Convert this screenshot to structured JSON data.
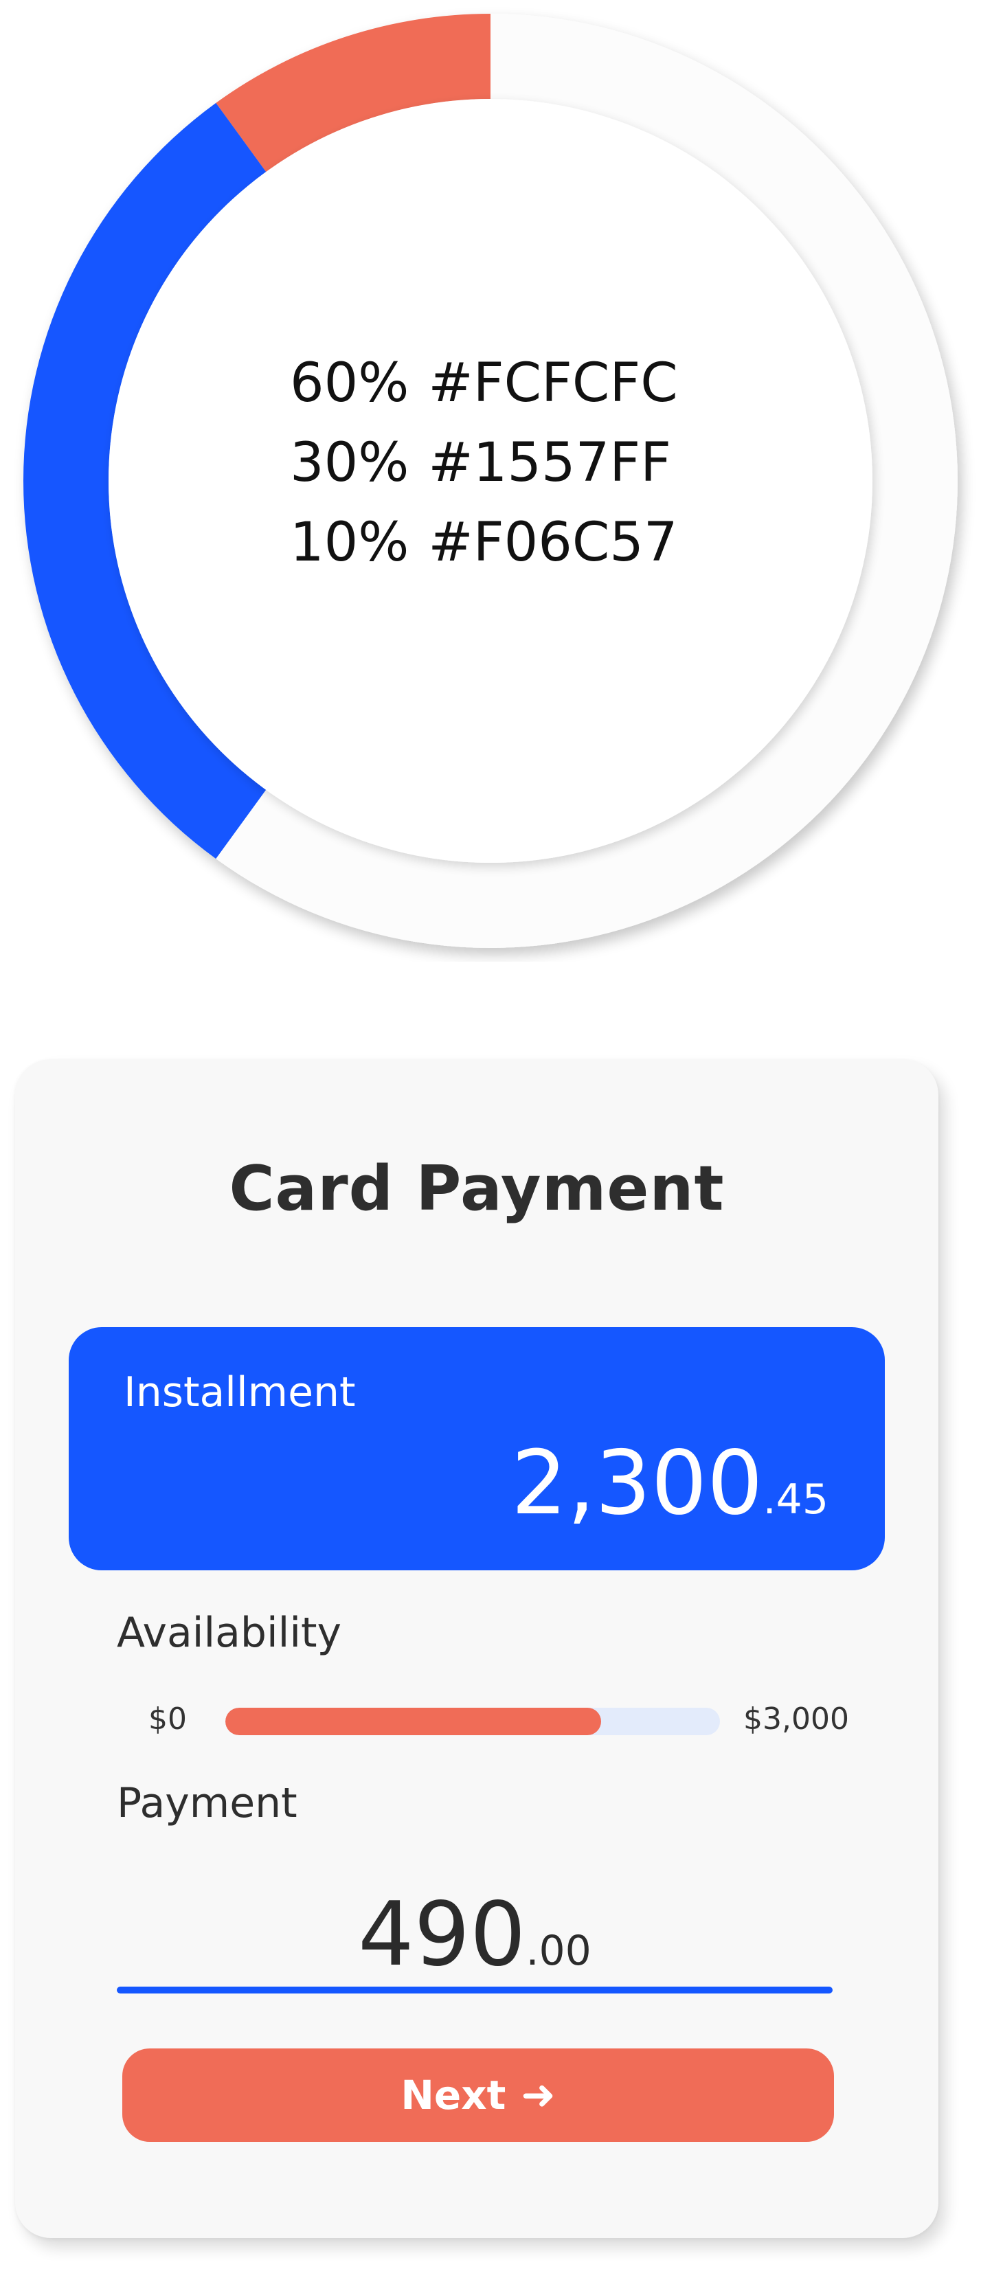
{
  "palette": {
    "surface": "#FCFCFC",
    "primary": "#1557FF",
    "accent": "#F06C57",
    "text": "#2E2E2E"
  },
  "chart_data": {
    "type": "pie",
    "categories": [
      "#FCFCFC",
      "#1557FF",
      "#F06C57"
    ],
    "values": [
      60,
      30,
      10
    ],
    "colors": [
      "#FCFCFC",
      "#1557FF",
      "#F06C57"
    ],
    "title": "",
    "legend": [
      {
        "percent": "60%",
        "label": "#FCFCFC"
      },
      {
        "percent": "30%",
        "label": "#1557FF"
      },
      {
        "percent": "10%",
        "label": "#F06C57"
      }
    ]
  },
  "card": {
    "title": "Card Payment",
    "installment": {
      "label": "Installment",
      "amount_whole": "2,300",
      "amount_cents": ".45"
    },
    "availability": {
      "label": "Availability",
      "min_label": "$0",
      "max_label": "$3,000",
      "fill_fraction": 0.76
    },
    "payment": {
      "label": "Payment",
      "amount_whole": "490",
      "amount_cents": ".00"
    },
    "next_button": {
      "label": "Next",
      "icon": "arrow-right-icon",
      "arrow_glyph": "➜"
    }
  }
}
